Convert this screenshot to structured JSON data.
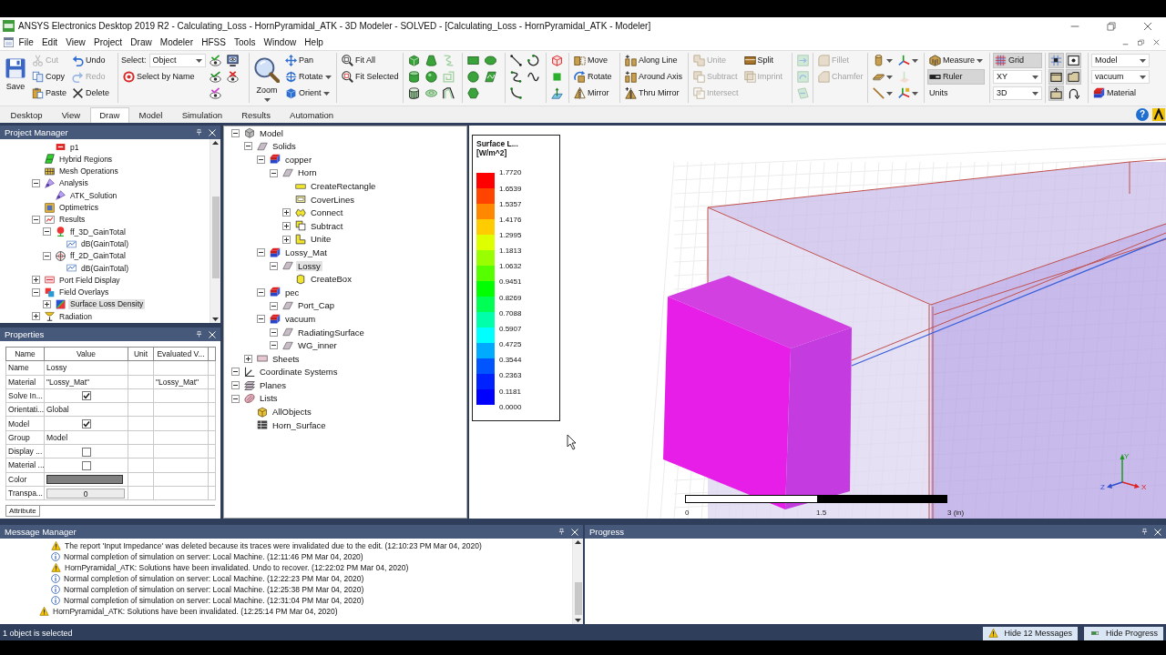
{
  "window": {
    "title": "ANSYS Electronics Desktop 2019 R2 - Calculating_Loss - HornPyramidal_ATK - 3D Modeler - SOLVED - [Calculating_Loss - HornPyramidal_ATK - Modeler]"
  },
  "menu": [
    "File",
    "Edit",
    "View",
    "Project",
    "Draw",
    "Modeler",
    "HFSS",
    "Tools",
    "Window",
    "Help"
  ],
  "ribbon": {
    "groups": [
      {
        "columns": [
          [
            {
              "kind": "large",
              "label": "Save",
              "disabled": false,
              "pressed": false
            }
          ],
          [
            {
              "kind": "small",
              "label": "Cut",
              "disabled": true,
              "pressed": false
            },
            {
              "kind": "small",
              "label": "Copy",
              "disabled": false,
              "pressed": false
            },
            {
              "kind": "small",
              "label": "Paste",
              "disabled": false,
              "pressed": false
            }
          ],
          [
            {
              "kind": "small",
              "label": "Undo",
              "disabled": false,
              "pressed": false
            },
            {
              "kind": "small",
              "label": "Redo",
              "disabled": true,
              "pressed": false
            },
            {
              "kind": "small",
              "label": "Delete",
              "disabled": false,
              "pressed": false
            }
          ]
        ]
      },
      {
        "columns": [
          [
            {
              "kind": "select",
              "label": "Select:",
              "value": "Object"
            },
            {
              "kind": "small",
              "label": "Select by Name",
              "disabled": false,
              "pressed": false
            }
          ],
          [
            {
              "kind": "icon",
              "disabled": false,
              "pressed": false
            },
            {
              "kind": "icon",
              "disabled": false,
              "pressed": false
            },
            {
              "kind": "icon",
              "disabled": false,
              "pressed": false
            }
          ],
          [
            {
              "kind": "icon",
              "disabled": false,
              "pressed": false
            },
            {
              "kind": "icon",
              "disabled": false,
              "pressed": false
            }
          ]
        ]
      },
      {
        "columns": [
          [
            {
              "kind": "large",
              "label": "Zoom",
              "dropdown": true,
              "disabled": false,
              "pressed": false
            }
          ],
          [
            {
              "kind": "small",
              "label": "Pan",
              "disabled": false,
              "pressed": false
            },
            {
              "kind": "small",
              "label": "Rotate",
              "dropdown": true,
              "disabled": false,
              "pressed": false
            },
            {
              "kind": "small",
              "label": "Orient",
              "dropdown": true,
              "disabled": false,
              "pressed": false
            }
          ]
        ]
      },
      {
        "columns": [
          [
            {
              "kind": "small",
              "label": "Fit All",
              "disabled": false,
              "pressed": false
            },
            {
              "kind": "small",
              "label": "Fit Selected",
              "disabled": false,
              "pressed": false
            }
          ]
        ]
      },
      {
        "columns": [
          [
            {
              "kind": "icon",
              "disabled": false,
              "pressed": false
            },
            {
              "kind": "icon",
              "disabled": false,
              "pressed": false
            },
            {
              "kind": "icon",
              "disabled": false,
              "pressed": false
            }
          ],
          [
            {
              "kind": "icon",
              "disabled": false,
              "pressed": false
            },
            {
              "kind": "icon",
              "disabled": false,
              "pressed": false
            },
            {
              "kind": "icon",
              "disabled": false,
              "pressed": false
            }
          ],
          [
            {
              "kind": "icon",
              "disabled": true,
              "pressed": false
            },
            {
              "kind": "icon",
              "disabled": true,
              "pressed": false
            },
            {
              "kind": "icon",
              "disabled": false,
              "pressed": false
            }
          ]
        ]
      },
      {
        "columns": [
          [
            {
              "kind": "icon",
              "disabled": false,
              "pressed": false
            },
            {
              "kind": "icon",
              "disabled": false,
              "pressed": false
            },
            {
              "kind": "icon",
              "disabled": false,
              "pressed": false
            }
          ],
          [
            {
              "kind": "icon",
              "disabled": false,
              "pressed": false
            },
            {
              "kind": "icon",
              "disabled": false,
              "pressed": false
            }
          ]
        ]
      },
      {
        "columns": [
          [
            {
              "kind": "icon",
              "disabled": false,
              "pressed": false
            },
            {
              "kind": "icon",
              "disabled": false,
              "pressed": false
            },
            {
              "kind": "icon",
              "disabled": false,
              "pressed": false
            }
          ],
          [
            {
              "kind": "icon",
              "disabled": false,
              "pressed": false
            },
            {
              "kind": "icon",
              "disabled": false,
              "pressed": false
            }
          ]
        ]
      },
      {
        "columns": [
          [
            {
              "kind": "icon",
              "disabled": false,
              "pressed": false
            },
            {
              "kind": "icon",
              "disabled": false,
              "pressed": false
            },
            {
              "kind": "icon",
              "disabled": false,
              "pressed": false
            }
          ]
        ]
      },
      {
        "columns": [
          [
            {
              "kind": "small",
              "label": "Move",
              "disabled": false,
              "pressed": false
            },
            {
              "kind": "small",
              "label": "Rotate",
              "disabled": false,
              "pressed": false
            },
            {
              "kind": "small",
              "label": "Mirror",
              "disabled": false,
              "pressed": false
            }
          ]
        ]
      },
      {
        "columns": [
          [
            {
              "kind": "small",
              "label": "Along Line",
              "disabled": false,
              "pressed": false
            },
            {
              "kind": "small",
              "label": "Around Axis",
              "disabled": false,
              "pressed": false
            },
            {
              "kind": "small",
              "label": "Thru Mirror",
              "disabled": false,
              "pressed": false
            }
          ]
        ]
      },
      {
        "columns": [
          [
            {
              "kind": "small",
              "label": "Unite",
              "disabled": true,
              "pressed": false
            },
            {
              "kind": "small",
              "label": "Subtract",
              "disabled": true,
              "pressed": false
            },
            {
              "kind": "small",
              "label": "Intersect",
              "disabled": true,
              "pressed": false
            }
          ],
          [
            {
              "kind": "small",
              "label": "Split",
              "disabled": false,
              "pressed": false
            },
            {
              "kind": "small",
              "label": "Imprint",
              "disabled": true,
              "pressed": false
            }
          ]
        ]
      },
      {
        "columns": [
          [
            {
              "kind": "icon",
              "disabled": true,
              "pressed": false
            },
            {
              "kind": "icon",
              "disabled": true,
              "pressed": false
            },
            {
              "kind": "icon",
              "disabled": true,
              "pressed": false
            }
          ]
        ]
      },
      {
        "columns": [
          [
            {
              "kind": "small",
              "label": "Fillet",
              "disabled": true,
              "pressed": false
            },
            {
              "kind": "small",
              "label": "Chamfer",
              "disabled": true,
              "pressed": false
            }
          ]
        ]
      },
      {
        "columns": [
          [
            {
              "kind": "icon",
              "dropdown": true,
              "disabled": false,
              "pressed": false
            },
            {
              "kind": "icon",
              "dropdown": true,
              "disabled": false,
              "pressed": false
            },
            {
              "kind": "icon",
              "dropdown": true,
              "disabled": false,
              "pressed": false
            }
          ],
          [
            {
              "kind": "icon",
              "dropdown": true,
              "disabled": false,
              "pressed": false
            },
            {
              "kind": "icon",
              "disabled": true,
              "pressed": false
            },
            {
              "kind": "icon",
              "dropdown": true,
              "disabled": false,
              "pressed": false
            }
          ]
        ]
      },
      {
        "columns": [
          [
            {
              "kind": "small",
              "label": "Measure",
              "dropdown": true,
              "disabled": false,
              "pressed": false
            },
            {
              "kind": "small",
              "label": "Ruler",
              "disabled": false,
              "pressed": true
            },
            {
              "kind": "text",
              "label": "Units",
              "disabled": false,
              "pressed": false
            }
          ]
        ]
      },
      {
        "columns": [
          [
            {
              "kind": "small",
              "label": "Grid",
              "disabled": false,
              "pressed": true
            },
            {
              "kind": "select",
              "value": "XY"
            },
            {
              "kind": "select",
              "value": "3D"
            }
          ]
        ]
      },
      {
        "columns": [
          [
            {
              "kind": "icon",
              "disabled": false,
              "pressed": true
            },
            {
              "kind": "icon",
              "disabled": false,
              "pressed": true
            },
            {
              "kind": "icon",
              "disabled": false,
              "pressed": true
            }
          ],
          [
            {
              "kind": "icon",
              "disabled": false,
              "pressed": true
            },
            {
              "kind": "icon",
              "disabled": false,
              "pressed": true
            },
            {
              "kind": "icon",
              "disabled": false,
              "pressed": false
            }
          ]
        ]
      },
      {
        "columns": [
          [
            {
              "kind": "select",
              "value": "Model"
            },
            {
              "kind": "select",
              "value": "vacuum"
            },
            {
              "kind": "small",
              "label": "Material",
              "disabled": false,
              "pressed": false
            }
          ]
        ]
      }
    ],
    "tabs": [
      {
        "label": "Desktop",
        "selected": false
      },
      {
        "label": "View",
        "selected": false
      },
      {
        "label": "Draw",
        "selected": true
      },
      {
        "label": "Model",
        "selected": false
      },
      {
        "label": "Simulation",
        "selected": false
      },
      {
        "label": "Results",
        "selected": false
      },
      {
        "label": "Automation",
        "selected": false
      }
    ],
    "help": "?"
  },
  "project_manager": {
    "title": "Project Manager",
    "items": [
      {
        "children": [
          {
            "kind": "port",
            "label": "p1",
            "selected": false
          }
        ]
      },
      {
        "kind": "hybrid",
        "label": "Hybrid Regions",
        "selected": false
      },
      {
        "kind": "mesh",
        "label": "Mesh Operations",
        "selected": false
      },
      {
        "kind": "analysis",
        "label": "Analysis",
        "expanded": true,
        "selected": false,
        "children": [
          {
            "kind": "analysis",
            "label": "ATK_Solution",
            "selected": false
          }
        ]
      },
      {
        "kind": "optimetrics",
        "label": "Optimetrics",
        "selected": false
      },
      {
        "kind": "results",
        "label": "Results",
        "expanded": true,
        "selected": false,
        "children": [
          {
            "kind": "farfield-3d",
            "label": "ff_3D_GainTotal",
            "expanded": true,
            "selected": false,
            "children": [
              {
                "kind": "plot",
                "label": "dB(GainTotal)",
                "selected": false
              }
            ]
          },
          {
            "kind": "farfield-2d",
            "label": "ff_2D_GainTotal",
            "expanded": true,
            "selected": false,
            "children": [
              {
                "kind": "plot",
                "label": "dB(GainTotal)",
                "selected": false
              }
            ]
          }
        ]
      },
      {
        "kind": "port-field",
        "label": "Port Field Display",
        "expanded": false,
        "selected": false
      },
      {
        "kind": "overlays",
        "label": "Field Overlays",
        "expanded": true,
        "selected": false,
        "children": [
          {
            "kind": "field-plot",
            "label": "Surface Loss Density",
            "expanded": false,
            "selected": true
          }
        ]
      },
      {
        "kind": "radiation",
        "label": "Radiation",
        "expanded": false,
        "selected": false
      }
    ]
  },
  "properties": {
    "title": "Properties",
    "columns": [
      "Name",
      "Value",
      "Unit",
      "Evaluated V..."
    ],
    "rows": [
      {
        "kind": "text",
        "name": "Name",
        "value": "Lossy"
      },
      {
        "kind": "text",
        "name": "Material",
        "value": "\"Lossy_Mat\"",
        "evaluated": "\"Lossy_Mat\""
      },
      {
        "kind": "check",
        "name": "Solve In...",
        "checked": true
      },
      {
        "kind": "text",
        "name": "Orientati...",
        "value": "Global"
      },
      {
        "kind": "check",
        "name": "Model",
        "checked": true
      },
      {
        "kind": "text",
        "name": "Group",
        "value": "Model"
      },
      {
        "kind": "check",
        "name": "Display ...",
        "checked": false
      },
      {
        "kind": "check",
        "name": "Material ...",
        "checked": false
      },
      {
        "kind": "color",
        "name": "Color",
        "color": "#808080"
      },
      {
        "kind": "number",
        "name": "Transpa...",
        "value": "0"
      }
    ],
    "tabs": [
      {
        "label": "Attribute",
        "selected": true
      }
    ]
  },
  "model_tree": {
    "items": [
      {
        "kind": "model",
        "label": "Model",
        "expanded": true,
        "selected": false,
        "children": [
          {
            "kind": "folder",
            "label": "Solids",
            "expanded": true,
            "selected": false,
            "children": [
              {
                "kind": "material",
                "label": "copper",
                "expanded": true,
                "selected": false,
                "children": [
                  {
                    "kind": "object",
                    "label": "Horn",
                    "expanded": true,
                    "selected": false,
                    "children": [
                      {
                        "kind": "rectangle-op",
                        "label": "CreateRectangle",
                        "selected": false
                      },
                      {
                        "kind": "cover-op",
                        "label": "CoverLines",
                        "selected": false
                      },
                      {
                        "kind": "connect-op",
                        "label": "Connect",
                        "expanded": false,
                        "selected": false
                      },
                      {
                        "kind": "subtract-op",
                        "label": "Subtract",
                        "expanded": false,
                        "selected": false
                      },
                      {
                        "kind": "unite-op",
                        "label": "Unite",
                        "expanded": false,
                        "selected": false
                      }
                    ]
                  }
                ]
              },
              {
                "kind": "material",
                "label": "Lossy_Mat",
                "expanded": true,
                "selected": false,
                "children": [
                  {
                    "kind": "object",
                    "label": "Lossy",
                    "expanded": true,
                    "selected": true,
                    "children": [
                      {
                        "kind": "box-op",
                        "label": "CreateBox",
                        "selected": false
                      }
                    ]
                  }
                ]
              },
              {
                "kind": "material",
                "label": "pec",
                "expanded": true,
                "selected": false,
                "children": [
                  {
                    "kind": "object",
                    "label": "Port_Cap",
                    "expanded": true,
                    "selected": false
                  }
                ]
              },
              {
                "kind": "material",
                "label": "vacuum",
                "expanded": true,
                "selected": false,
                "children": [
                  {
                    "kind": "object",
                    "label": "RadiatingSurface",
                    "expanded": true,
                    "selected": false
                  },
                  {
                    "kind": "object",
                    "label": "WG_inner",
                    "expanded": true,
                    "selected": false
                  }
                ]
              }
            ]
          },
          {
            "kind": "sheet-folder",
            "label": "Sheets",
            "expanded": false,
            "selected": false
          }
        ]
      },
      {
        "kind": "coordinates",
        "label": "Coordinate Systems",
        "expanded": true,
        "selected": false
      },
      {
        "kind": "planes",
        "label": "Planes",
        "expanded": true,
        "selected": false
      },
      {
        "kind": "lists",
        "label": "Lists",
        "expanded": true,
        "selected": false,
        "children": [
          {
            "kind": "list-all",
            "label": "AllObjects",
            "selected": false
          },
          {
            "kind": "list",
            "label": "Horn_Surface",
            "selected": false
          }
        ]
      }
    ]
  },
  "viewport": {
    "legend": {
      "title": "Surface L...",
      "unit": "[W/m^2]",
      "values": [
        "1.7720",
        "1.6539",
        "1.5357",
        "1.4176",
        "1.2995",
        "1.1813",
        "1.0632",
        "0.9451",
        "0.8269",
        "0.7088",
        "0.5907",
        "0.4725",
        "0.3544",
        "0.2363",
        "0.1181",
        "0.0000"
      ],
      "bands": [
        {
          "color": "#ff0000"
        },
        {
          "color": "#ff4400"
        },
        {
          "color": "#ff8800"
        },
        {
          "color": "#ffcc00"
        },
        {
          "color": "#ddff00"
        },
        {
          "color": "#99ff00"
        },
        {
          "color": "#55ff00"
        },
        {
          "color": "#00ff00"
        },
        {
          "color": "#00ff55"
        },
        {
          "color": "#00ffaa"
        },
        {
          "color": "#00ffff"
        },
        {
          "color": "#00aaff"
        },
        {
          "color": "#0055ff"
        },
        {
          "color": "#0022ff"
        },
        {
          "color": "#0000ff"
        }
      ]
    },
    "scale_bar": {
      "labels": [
        "0",
        "1.5",
        "3 (in)"
      ]
    },
    "axes": {
      "x": "X",
      "y": "Y",
      "z": "Z"
    }
  },
  "message_manager": {
    "title": "Message Manager",
    "messages": [
      {
        "children": [
          {
            "kind": "warning",
            "text": "The report 'Input Impedance' was deleted because its traces were invalidated due to the edit. (12:10:23 PM Mar 04, 2020)"
          },
          {
            "kind": "info",
            "text": "Normal completion of simulation on server: Local Machine. (12:11:46 PM Mar 04, 2020)"
          },
          {
            "kind": "warning",
            "text": "HornPyramidal_ATK: Solutions have been invalidated. Undo to recover. (12:22:02 PM Mar 04, 2020)"
          },
          {
            "kind": "info",
            "text": "Normal completion of simulation on server: Local Machine. (12:22:23 PM Mar 04, 2020)"
          },
          {
            "kind": "info",
            "text": "Normal completion of simulation on server: Local Machine. (12:25:38 PM Mar 04, 2020)"
          },
          {
            "kind": "info",
            "text": "Normal completion of simulation on server: Local Machine. (12:31:04 PM Mar 04, 2020)"
          }
        ]
      },
      {
        "kind": "warning",
        "text": "HornPyramidal_ATK: Solutions have been invalidated. (12:25:14 PM Mar 04, 2020)"
      }
    ]
  },
  "progress": {
    "title": "Progress"
  },
  "status_bar": {
    "text": "1 object is selected",
    "buttons": [
      {
        "kind": "warning",
        "label": "Hide 12 Messages"
      },
      {
        "kind": "progress",
        "label": "Hide Progress"
      }
    ]
  }
}
